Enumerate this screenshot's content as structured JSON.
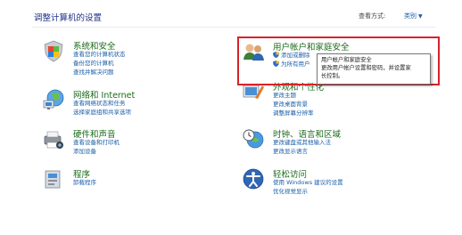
{
  "header": {
    "title": "调整计算机的设置",
    "view_by_label": "查看方式:",
    "view_by_value": "类别"
  },
  "categories": [
    {
      "title": "系统和安全",
      "icon": "shield-flag-icon",
      "links": [
        "查看您的计算机状态",
        "备份您的计算机",
        "查找并解决问题"
      ]
    },
    {
      "title": "网络和 Internet",
      "icon": "network-globe-icon",
      "links": [
        "查看网络状态和任务",
        "选择家庭组和共享选项"
      ]
    },
    {
      "title": "硬件和声音",
      "icon": "printer-camera-icon",
      "links": [
        "查看设备和打印机",
        "添加设备"
      ]
    },
    {
      "title": "程序",
      "icon": "programs-icon",
      "links": [
        "卸载程序"
      ]
    },
    {
      "title": "用户帐户和家庭安全",
      "icon": "users-icon",
      "links": [
        "添加或删除",
        "为所有用户"
      ]
    },
    {
      "title": "外观和个性化",
      "icon": "appearance-icon",
      "links": [
        "更改主题",
        "更改桌面背景",
        "调整屏幕分辨率"
      ]
    },
    {
      "title": "时钟、语言和区域",
      "icon": "clock-globe-icon",
      "links": [
        "更改键盘或其他输入法",
        "更改显示语言"
      ]
    },
    {
      "title": "轻松访问",
      "icon": "ease-of-access-icon",
      "links": [
        "使用 Windows 建议的设置",
        "优化视觉显示"
      ]
    }
  ],
  "tooltip": {
    "lines": [
      "用户帐户和家庭安全",
      "更改用户帐户设置和密码，并设置家",
      "长控制。"
    ]
  },
  "colors": {
    "title_green": "#1a6a1a",
    "link_blue": "#1a5ea8",
    "highlight_red": "#d8222a"
  }
}
